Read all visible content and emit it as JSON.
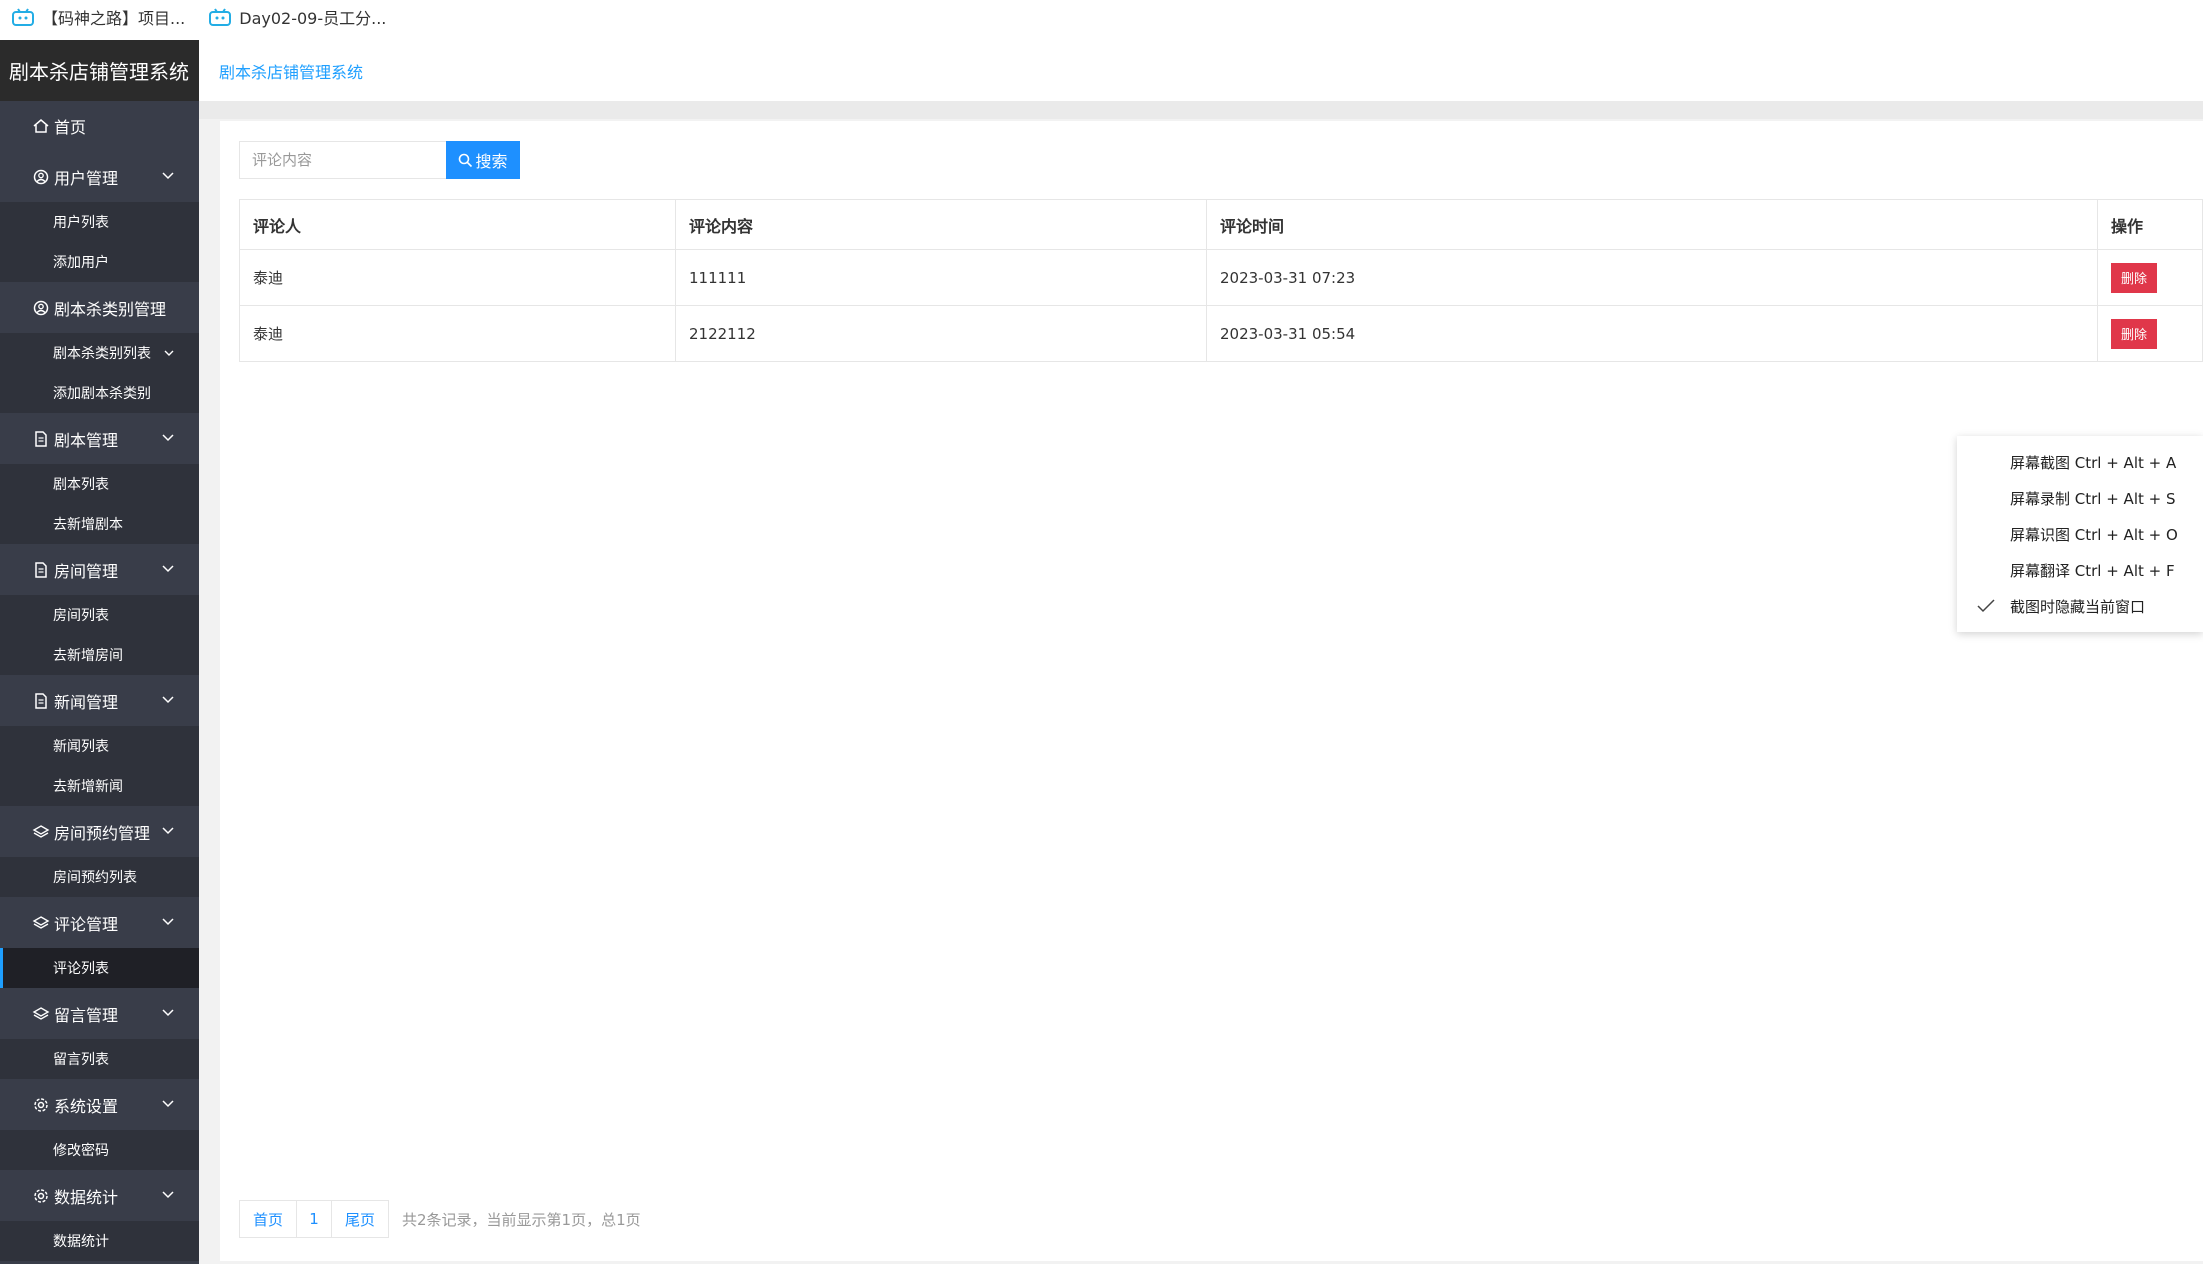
{
  "bookmarks": [
    {
      "label": "【码神之路】项目...",
      "icon": "bilibili-icon"
    },
    {
      "label": "Day02-09-员工分...",
      "icon": "bilibili-icon"
    }
  ],
  "app": {
    "brand": "剧本杀店铺管理系统",
    "header_title": "剧本杀店铺管理系统"
  },
  "sidebar": {
    "home": {
      "label": "首页",
      "icon": "home-icon"
    },
    "groups": [
      {
        "label": "用户管理",
        "icon": "user-circle-icon",
        "items": [
          "用户列表",
          "添加用户"
        ]
      },
      {
        "label": "剧本杀类别管理",
        "icon": "user-circle-icon",
        "items": [
          "剧本杀类别列表",
          "添加剧本杀类别"
        ]
      },
      {
        "label": "剧本管理",
        "icon": "file-icon",
        "items": [
          "剧本列表",
          "去新增剧本"
        ]
      },
      {
        "label": "房间管理",
        "icon": "file-icon",
        "items": [
          "房间列表",
          "去新增房间"
        ]
      },
      {
        "label": "新闻管理",
        "icon": "file-icon",
        "items": [
          "新闻列表",
          "去新增新闻"
        ]
      },
      {
        "label": "房间预约管理",
        "icon": "layers-icon",
        "items": [
          "房间预约列表"
        ]
      },
      {
        "label": "评论管理",
        "icon": "layers-icon",
        "items": [
          "评论列表"
        ]
      },
      {
        "label": "留言管理",
        "icon": "layers-icon",
        "items": [
          "留言列表"
        ]
      },
      {
        "label": "系统设置",
        "icon": "gear-icon",
        "items": [
          "修改密码"
        ]
      },
      {
        "label": "数据统计",
        "icon": "gear-icon",
        "items": [
          "数据统计"
        ]
      }
    ],
    "active_item": "评论列表"
  },
  "search": {
    "placeholder": "评论内容",
    "value": "",
    "button_label": "搜索"
  },
  "table": {
    "columns": [
      "评论人",
      "评论内容",
      "评论时间",
      "操作"
    ],
    "rows": [
      {
        "commenter": "泰迪",
        "content": "111111",
        "time": "2023-03-31 07:23",
        "action": "删除"
      },
      {
        "commenter": "泰迪",
        "content": "2122112",
        "time": "2023-03-31 05:54",
        "action": "删除"
      }
    ]
  },
  "context_menu": {
    "items": [
      {
        "label": "屏幕截图 Ctrl + Alt + A",
        "checked": false
      },
      {
        "label": "屏幕录制 Ctrl + Alt + S",
        "checked": false
      },
      {
        "label": "屏幕识图 Ctrl + Alt + O",
        "checked": false
      },
      {
        "label": "屏幕翻译 Ctrl + Alt + F",
        "checked": false
      },
      {
        "label": "截图时隐藏当前窗口",
        "checked": true
      }
    ]
  },
  "pagination": {
    "first": "首页",
    "current": "1",
    "last": "尾页",
    "info": "共2条记录，当前显示第1页，总1页"
  },
  "colors": {
    "sidebar_bg": "#393d49",
    "submenu_bg": "#2f323b",
    "accent": "#1e90ff",
    "delete": "#e0374a"
  }
}
